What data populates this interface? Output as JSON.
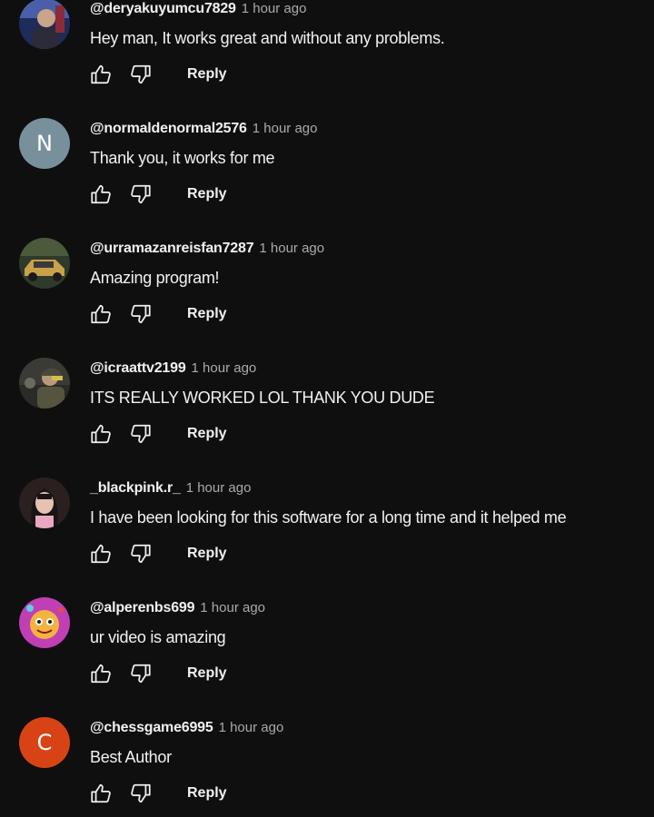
{
  "comments": [
    {
      "handle": "@deryakuyumcu7829",
      "time": "1 hour ago",
      "text": "Hey man, It works great and without any problems.",
      "avatar": {
        "type": "image",
        "icon": "person-photo-avatar",
        "bg": "#2a3a6e"
      },
      "reply_label": "Reply"
    },
    {
      "handle": "@normaldenormal2576",
      "time": "1 hour ago",
      "text": "Thank you, it works for me",
      "avatar": {
        "type": "letter",
        "letter": "N",
        "bg": "#78909c"
      },
      "reply_label": "Reply"
    },
    {
      "handle": "@urramazanreisfan7287",
      "time": "1 hour ago",
      "text": "Amazing program!",
      "avatar": {
        "type": "image",
        "icon": "car-photo-avatar",
        "bg": "#3b3a2a"
      },
      "reply_label": "Reply"
    },
    {
      "handle": "@icraattv2199",
      "time": "1 hour ago",
      "text": "ITS REALLY WORKED LOL THANK YOU DUDE",
      "avatar": {
        "type": "image",
        "icon": "soldier-photo-avatar",
        "bg": "#3a3a34"
      },
      "reply_label": "Reply"
    },
    {
      "handle": "_blackpink.r_",
      "time": "1 hour ago",
      "text": "I have been looking for this software for a long time and it helped me",
      "avatar": {
        "type": "image",
        "icon": "woman-photo-avatar",
        "bg": "#2e2424"
      },
      "reply_label": "Reply"
    },
    {
      "handle": "@alperenbs699",
      "time": "1 hour ago",
      "text": "ur video is amazing",
      "avatar": {
        "type": "image",
        "icon": "cartoon-photo-avatar",
        "bg": "#c03fb4"
      },
      "reply_label": "Reply"
    },
    {
      "handle": "@chessgame6995",
      "time": "1 hour ago",
      "text": "Best Author",
      "avatar": {
        "type": "letter",
        "letter": "C",
        "bg": "#d84315"
      },
      "reply_label": "Reply"
    }
  ],
  "colors": {
    "background": "#0f0f0f",
    "text": "#f1f1f1",
    "secondary_text": "#aaaaaa"
  }
}
